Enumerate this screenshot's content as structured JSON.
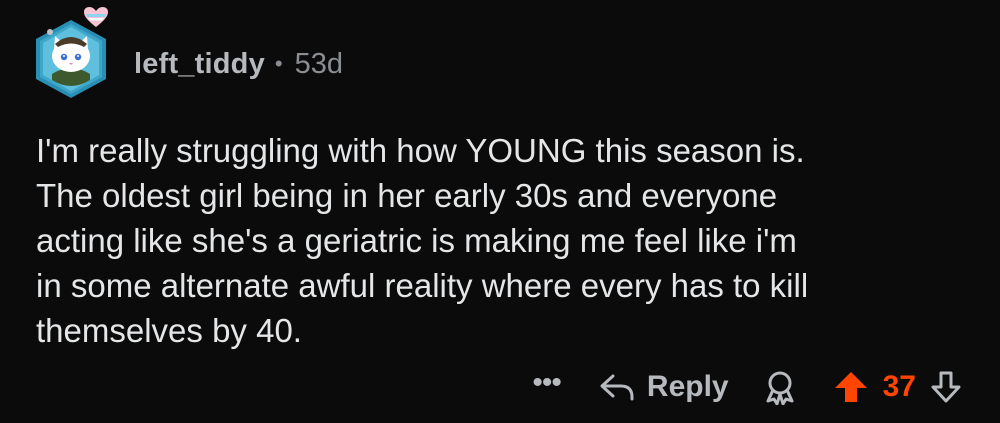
{
  "comment": {
    "username": "left_tiddy",
    "separator": "•",
    "age": "53d",
    "body_lines": [
      "I'm really struggling with how YOUNG this season is.",
      "The oldest girl being in her early 30s and everyone",
      "acting like she's a geriatric is making me feel like i'm",
      "in some alternate awful reality where every has to kill",
      "themselves by 40."
    ]
  },
  "actions": {
    "more_label": "•••",
    "reply_label": "Reply",
    "score": "37"
  },
  "colors": {
    "background": "#0b0b0b",
    "upvote_active": "#ff4500",
    "text": "#e4e6e8",
    "muted": "#8a8d91"
  },
  "icons": [
    "avatar",
    "heart-icon",
    "reply-icon",
    "award-icon",
    "upvote-icon",
    "downvote-icon"
  ]
}
